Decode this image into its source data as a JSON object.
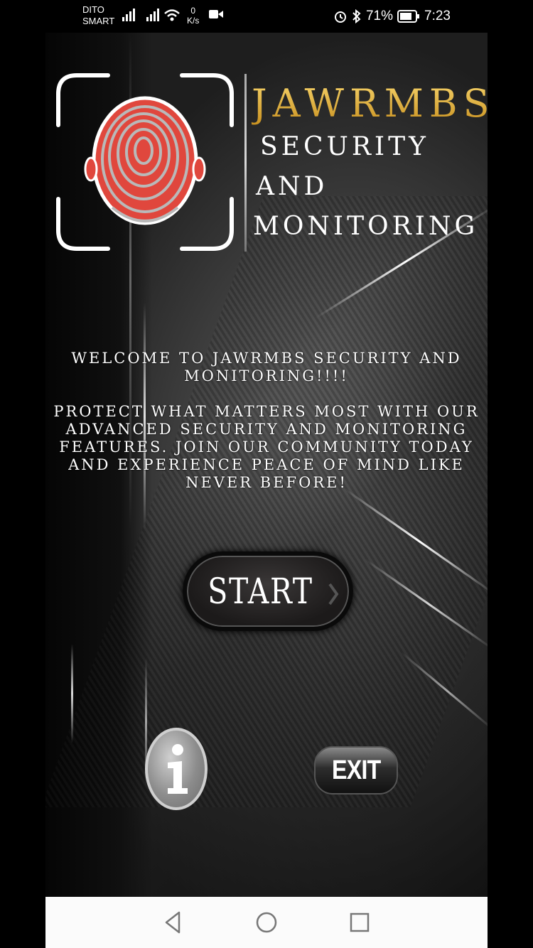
{
  "status_bar": {
    "carrier_line1": "DITO",
    "carrier_line2": "SMART",
    "net_speed_value": "0",
    "net_speed_unit": "K/s",
    "battery_percent": "71%",
    "time": "7:23",
    "icons": [
      "signal-icon",
      "signal-icon",
      "wifi-icon",
      "video-icon",
      "alarm-icon",
      "bluetooth-icon",
      "battery-icon"
    ]
  },
  "brand": {
    "name": "JAWRMBS",
    "line1": "SECURITY",
    "line2": "AND",
    "line3": "MONITORING"
  },
  "welcome": {
    "heading_line1": "WELCOME TO JAWRMBS SECURITY AND",
    "heading_line2": "MONITORING!!!!",
    "body_line1": "PROTECT WHAT MATTERS MOST WITH OUR",
    "body_line2": "ADVANCED SECURITY AND MONITORING",
    "body_line3": "FEATURES. JOIN OUR COMMUNITY TODAY",
    "body_line4": "AND EXPERIENCE PEACE OF MIND LIKE",
    "body_line5": "NEVER BEFORE!"
  },
  "buttons": {
    "start_label": "START",
    "info_icon": "info-icon",
    "exit_label": "EXIT"
  },
  "nav": {
    "back_icon": "back-triangle-icon",
    "home_icon": "home-circle-icon",
    "recents_icon": "recents-square-icon"
  },
  "colors": {
    "brand_gold": "#e9b53a",
    "fingerprint_red": "#e0473d",
    "background_dark": "#1e1e1e"
  }
}
